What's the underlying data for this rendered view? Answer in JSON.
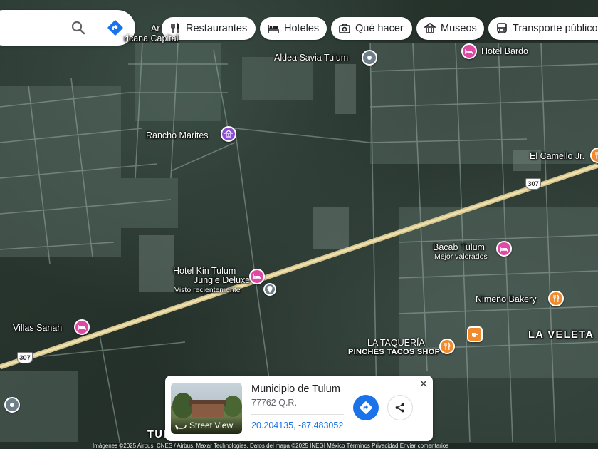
{
  "search": {
    "search_icon": "search-icon",
    "directions_icon": "directions-icon"
  },
  "chips": [
    {
      "label": "Restaurantes",
      "icon": "restaurant-icon"
    },
    {
      "label": "Hoteles",
      "icon": "hotel-icon"
    },
    {
      "label": "Qué hacer",
      "icon": "camera-icon"
    },
    {
      "label": "Museos",
      "icon": "museum-icon"
    },
    {
      "label": "Transporte público",
      "icon": "transit-icon"
    }
  ],
  "places": {
    "aldea": "Aldea Savia Tulum",
    "bardo": "Hotel Bardo",
    "rancho": "Rancho Marites",
    "camello": "El Camello Jr.",
    "bacab": "Bacab Tulum",
    "bacab_sub": "Mejor valorados",
    "kin1": "Hotel Kin Tulum",
    "kin2": "Jungle Deluxe",
    "kin_sub": "Visto recientemente",
    "nimeno": "Nimeño Bakery",
    "villas": "Villas Sanah",
    "taqueria": "LA TAQUERÍA",
    "taqueria_sub": "PINCHES TACOS SHOP",
    "veleta": "LA VELETA",
    "topleft": "Ar",
    "topleft2": "ricana Capital",
    "tul": "TUL"
  },
  "road_shields": [
    "307",
    "307"
  ],
  "card": {
    "title": "Municipio de Tulum",
    "subtitle": "77762 Q.R.",
    "coords": "20.204135, -87.483052",
    "street_view": "Street View",
    "close": "✕"
  },
  "attribution": "Imágenes ©2025 Airbus, CNES / Airbus, Maxar Technologies, Datos del mapa ©2025 INEGI   México   Términos   Privacidad   Enviar comentarios"
}
